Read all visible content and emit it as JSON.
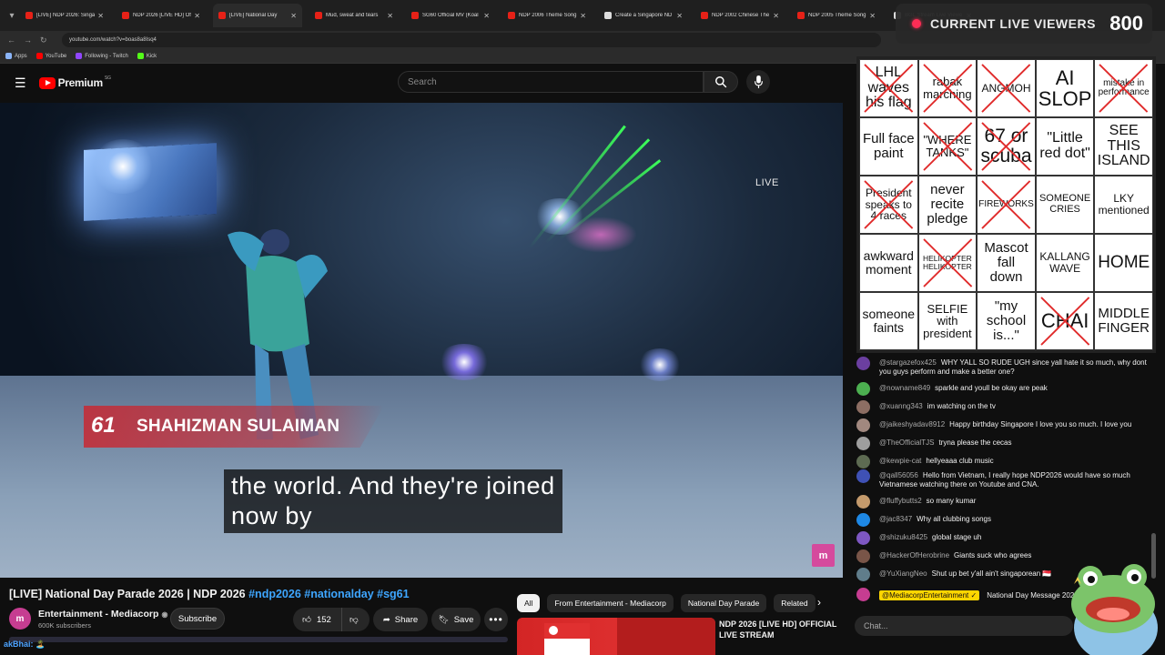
{
  "browser": {
    "tabs": [
      {
        "title": "[LIVE] NDP 2026: Singap",
        "icon": "youtube",
        "active": false
      },
      {
        "title": "NDP 2026 [LIVE HD] Of",
        "icon": "youtube",
        "active": false
      },
      {
        "title": "[LIVE] National Day",
        "icon": "youtube",
        "active": true
      },
      {
        "title": "Mud, sweat and tears",
        "icon": "youtube",
        "active": false
      },
      {
        "title": "SG60 Official MV (Koal",
        "icon": "youtube",
        "active": false
      },
      {
        "title": "NDP 2006 Theme Song",
        "icon": "youtube",
        "active": false
      },
      {
        "title": "Create a Singapore ND",
        "icon": "page",
        "active": false
      },
      {
        "title": "NDP 2002 Chinese The",
        "icon": "youtube",
        "active": false
      },
      {
        "title": "NDP 2005 Theme Song",
        "icon": "youtube",
        "active": false
      },
      {
        "title": "BGL Stream Live Viewe",
        "icon": "page",
        "active": false
      }
    ],
    "url": "youtube.com/watch?v=boas8a8Isq4",
    "bookmarks": [
      "Apps",
      "YouTube",
      "Following - Twitch",
      "Kick"
    ]
  },
  "youtube": {
    "logo_word": "Premium",
    "country_code": "SG",
    "search_placeholder": "Search"
  },
  "video": {
    "live_label": "LIVE",
    "lower_third_name": "SHAHIZMAN SULAIMAN",
    "lower_third_logo": "61",
    "caption_line1": "the world. And they're joined",
    "caption_line2": "now by",
    "channel_badge": "m"
  },
  "below_video": {
    "title_main": "[LIVE] National Day Parade 2026 | NDP 2026 ",
    "title_tags": "#ndp2026 #nationalday #sg61",
    "channel_name": "Entertainment - Mediacorp",
    "channel_initial": "m",
    "subscribers": "600K subscribers",
    "subscribe_label": "Subscribe",
    "like_count": "152",
    "share_label": "Share",
    "save_label": "Save",
    "more_label": "•••"
  },
  "chips": [
    "All",
    "From Entertainment - Mediacorp",
    "National Day Parade",
    "Related"
  ],
  "recommendation": {
    "title": "NDP 2026 [LIVE HD] OFFICIAL LIVE STREAM"
  },
  "overlay_user": {
    "name": "akBhai:",
    "emoji": "🏝️"
  },
  "viewers_widget": {
    "label": "CURRENT LIVE VIEWERS",
    "count": "800"
  },
  "bingo": {
    "cells": [
      {
        "text": "LHL waves his flag",
        "size": 16,
        "crossed": true
      },
      {
        "text": "rabak marching",
        "size": 13,
        "crossed": true
      },
      {
        "text": "ANGMOH",
        "size": 12,
        "crossed": true
      },
      {
        "text": "AI SLOP",
        "size": 22,
        "crossed": false
      },
      {
        "text": "mistake in performance",
        "size": 10,
        "crossed": true
      },
      {
        "text": "Full face paint",
        "size": 15,
        "crossed": false
      },
      {
        "text": "\"WHERE TANKS\"",
        "size": 13,
        "crossed": true
      },
      {
        "text": "67 or scuba",
        "size": 21,
        "crossed": true
      },
      {
        "text": "\"Little red dot\"",
        "size": 16,
        "crossed": false
      },
      {
        "text": "SEE THIS ISLAND",
        "size": 16,
        "crossed": false
      },
      {
        "text": "President speaks to 4 races",
        "size": 12,
        "crossed": true
      },
      {
        "text": "never recite pledge",
        "size": 15,
        "crossed": false
      },
      {
        "text": "FIREWORKS",
        "size": 10,
        "crossed": true
      },
      {
        "text": "SOMEONE CRIES",
        "size": 11,
        "crossed": false
      },
      {
        "text": "LKY mentioned",
        "size": 12,
        "crossed": false
      },
      {
        "text": "awkward moment",
        "size": 14,
        "crossed": false
      },
      {
        "text": "HELIKOPTER HELIKOPTER",
        "size": 8.5,
        "crossed": true
      },
      {
        "text": "Mascot fall down",
        "size": 15,
        "crossed": false
      },
      {
        "text": "KALLANG WAVE",
        "size": 12,
        "crossed": false
      },
      {
        "text": "HOME",
        "size": 19,
        "crossed": false
      },
      {
        "text": "someone faints",
        "size": 14,
        "crossed": false
      },
      {
        "text": "SELFIE with president",
        "size": 13,
        "crossed": false
      },
      {
        "text": "\"my school is...\"",
        "size": 15,
        "crossed": false
      },
      {
        "text": "CHAI",
        "size": 22,
        "crossed": true
      },
      {
        "text": "MIDDLE FINGER",
        "size": 15,
        "crossed": false
      }
    ]
  },
  "chat": {
    "messages": [
      {
        "author": "@stargazefox425",
        "text": "WHY YALL SO RUDE UGH since yall hate it so much, why dont you guys perform and make a better one?",
        "avatar_color": "#6b3fa0"
      },
      {
        "author": "@nowname849",
        "text": "sparkle and youll be okay are peak",
        "avatar_color": "#4caf50"
      },
      {
        "author": "@xuanng343",
        "text": "im watching on the tv",
        "avatar_color": "#8d6e63"
      },
      {
        "author": "@jaikeshyadav8912",
        "text": "Happy birthday Singapore I love you so much. I love you",
        "avatar_color": "#a1887f"
      },
      {
        "author": "@TheOfficialTJS",
        "text": "tryna please the cecas",
        "avatar_color": "#9e9e9e"
      },
      {
        "author": "@kewpie-cat",
        "text": "hellyeaaa club music",
        "avatar_color": "#5d6b52"
      },
      {
        "author": "@qall56056",
        "text": "Hello from Vietnam, I really hope NDP2026 would have so much Vietnamese watching there on Youtube and CNA.",
        "avatar_color": "#3f51b5"
      },
      {
        "author": "@fluffybutts2",
        "text": "so many kumar",
        "avatar_color": "#c49a6c"
      },
      {
        "author": "@jac8347",
        "text": "Why all clubbing songs",
        "avatar_color": "#1e88e5"
      },
      {
        "author": "@shizuku8425",
        "text": "global stage uh",
        "avatar_color": "#7e57c2"
      },
      {
        "author": "@HackerOfHerobrine",
        "text": "Giants suck who agrees",
        "avatar_color": "#795548"
      },
      {
        "author": "@YuXiangNeo",
        "text": "Shut up bet y'all ain't singaporean 🇸🇬",
        "avatar_color": "#607d8b"
      }
    ],
    "pinned_author": "@MediacorpEntertainment ✓",
    "pinned_text": "National Day Message 2026",
    "input_placeholder": "Chat..."
  }
}
